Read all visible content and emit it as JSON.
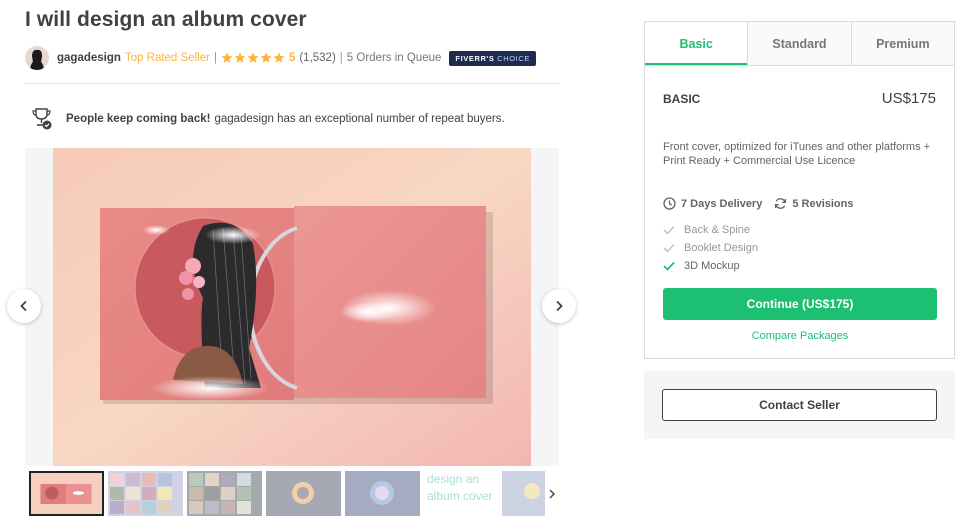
{
  "gig": {
    "title": "I will design an album cover"
  },
  "seller": {
    "name": "gagadesign",
    "level": "Top Rated Seller",
    "separator": "|",
    "rating": "5",
    "review_count": "(1,532)",
    "orders_in_queue": "5 Orders in Queue",
    "badge_main": "FIVERR'S",
    "badge_light": "CHOICE",
    "stars": 5,
    "icon_avatar": "avatar",
    "icon_star": "star-icon"
  },
  "repeat_buyers": {
    "bold": "People keep coming back!",
    "text": "gagadesign has an exceptional number of repeat buyers.",
    "icon": "trophy-icon"
  },
  "gallery": {
    "thumb_alt": "design an album cover",
    "prev_icon": "chevron-left-icon",
    "next_icon": "chevron-right-icon"
  },
  "packages": {
    "tabs": [
      {
        "label": "Basic",
        "active": true
      },
      {
        "label": "Standard",
        "active": false
      },
      {
        "label": "Premium",
        "active": false
      }
    ],
    "selected": {
      "name": "BASIC",
      "price": "US$175",
      "description": "Front cover, optimized for iTunes and other platforms + Print Ready + Commercial Use Licence",
      "delivery": "7 Days Delivery",
      "revisions": "5 Revisions",
      "features": [
        {
          "label": "Back & Spine",
          "included": false
        },
        {
          "label": "Booklet Design",
          "included": false
        },
        {
          "label": "3D Mockup",
          "included": true
        }
      ]
    },
    "continue_label": "Continue (US$175)",
    "compare_label": "Compare Packages"
  },
  "contact": {
    "label": "Contact Seller"
  },
  "colors": {
    "brand_green": "#1dbf73",
    "star_gold": "#ffb33e",
    "text_dark": "#404145",
    "text_muted": "#74767e",
    "badge_navy": "#1e2b4f"
  }
}
